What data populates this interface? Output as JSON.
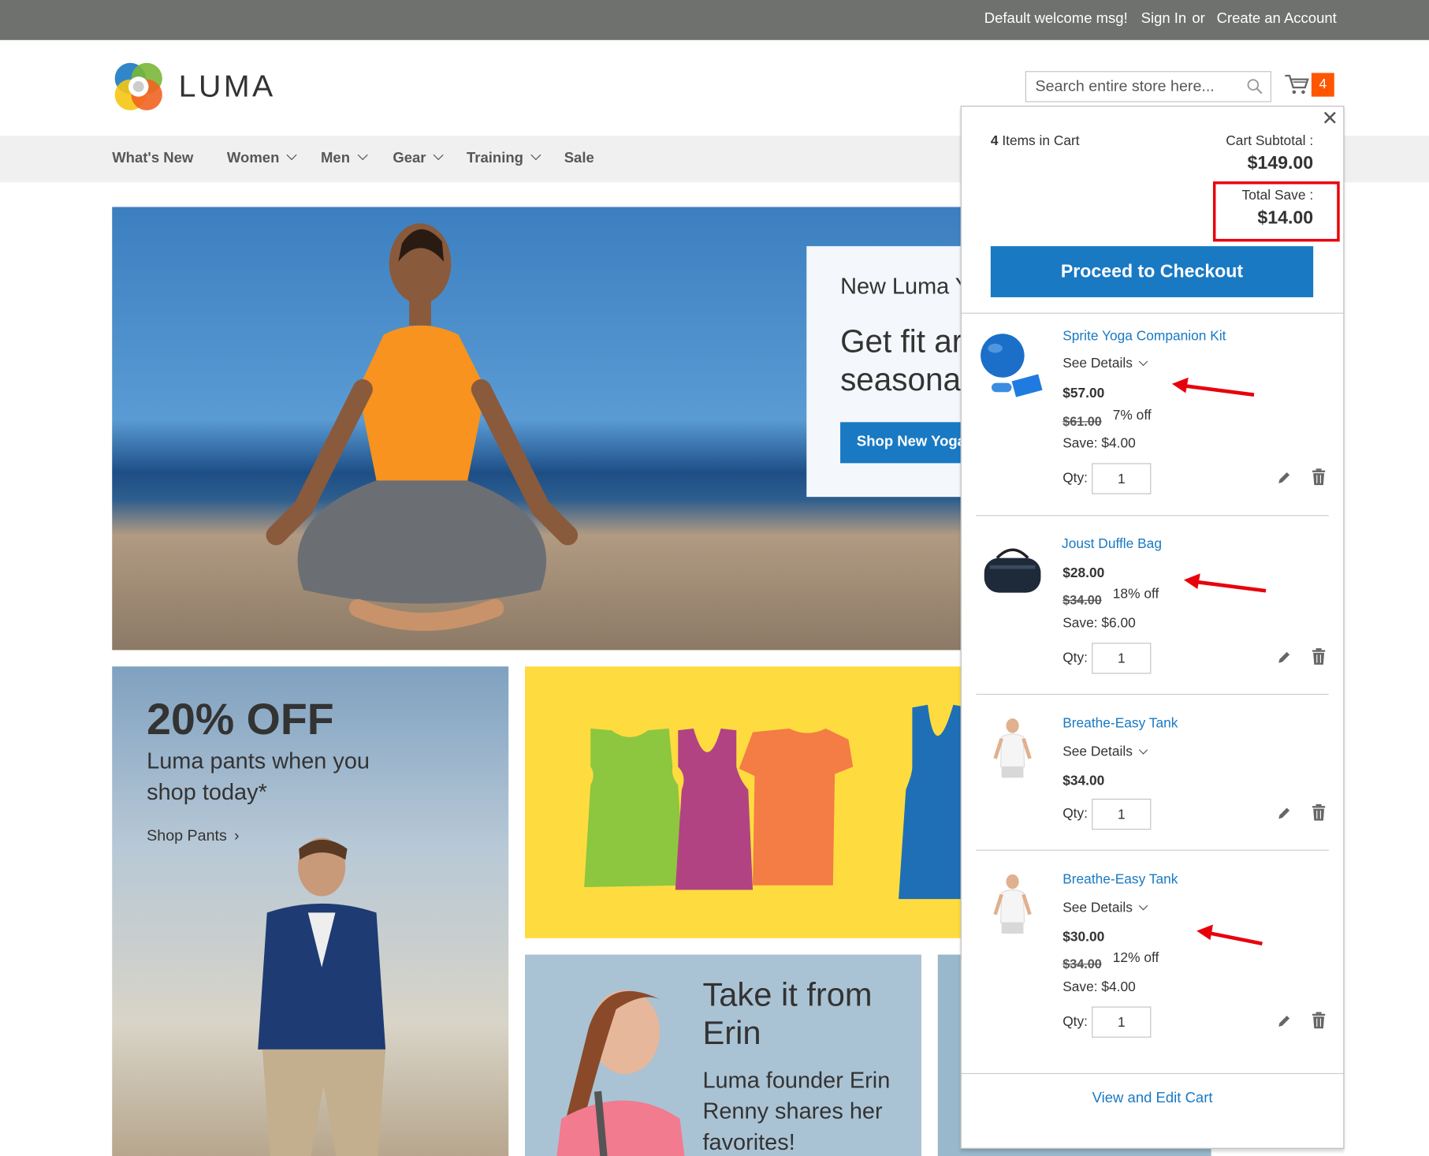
{
  "topbar": {
    "welcome": "Default welcome msg!",
    "sign_in": "Sign In",
    "or": "or",
    "create_account": "Create an Account"
  },
  "header": {
    "logo_text": "LUMA",
    "search_placeholder": "Search entire store here...",
    "cart_count": "4"
  },
  "nav": {
    "items": [
      {
        "label": "What's New",
        "has_dropdown": false
      },
      {
        "label": "Women",
        "has_dropdown": true
      },
      {
        "label": "Men",
        "has_dropdown": true
      },
      {
        "label": "Gear",
        "has_dropdown": true
      },
      {
        "label": "Training",
        "has_dropdown": true
      },
      {
        "label": "Sale",
        "has_dropdown": false
      }
    ]
  },
  "hero": {
    "subtitle": "New Luma Y",
    "title": "Get fit ar\nseasona",
    "button": "Shop New Yoga"
  },
  "promo_pants": {
    "title": "20% OFF",
    "subtitle": "Luma pants when you\nshop today*",
    "link": "Shop Pants"
  },
  "promo_erin": {
    "title": "Take it from\nErin",
    "subtitle": "Luma founder Erin\nRenny shares her\nfavorites!"
  },
  "minicart": {
    "count_number": "4",
    "count_label": "Items in Cart",
    "subtotal_label": "Cart Subtotal :",
    "subtotal_value": "$149.00",
    "total_save_label": "Total Save :",
    "total_save_value": "$14.00",
    "checkout_label": "Proceed to Checkout",
    "view_cart_label": "View and Edit Cart",
    "items": [
      {
        "name": "Sprite Yoga Companion Kit",
        "details": "See Details",
        "price": "$57.00",
        "old_price": "$61.00",
        "discount": "7% off",
        "save": "Save: $4.00",
        "qty_label": "Qty:",
        "qty": "1"
      },
      {
        "name": "Joust Duffle Bag",
        "price": "$28.00",
        "old_price": "$34.00",
        "discount": "18% off",
        "save": "Save: $6.00",
        "qty_label": "Qty:",
        "qty": "1"
      },
      {
        "name": "Breathe-Easy Tank",
        "details": "See Details",
        "price": "$34.00",
        "qty_label": "Qty:",
        "qty": "1"
      },
      {
        "name": "Breathe-Easy Tank",
        "details": "See Details",
        "price": "$30.00",
        "old_price": "$34.00",
        "discount": "12% off",
        "save": "Save: $4.00",
        "qty_label": "Qty:",
        "qty": "1"
      }
    ]
  },
  "colors": {
    "topbar_bg": "#6e716e",
    "link_blue": "#1979c3",
    "counter_orange": "#ff5501",
    "highlight_red": "#e8000b"
  }
}
